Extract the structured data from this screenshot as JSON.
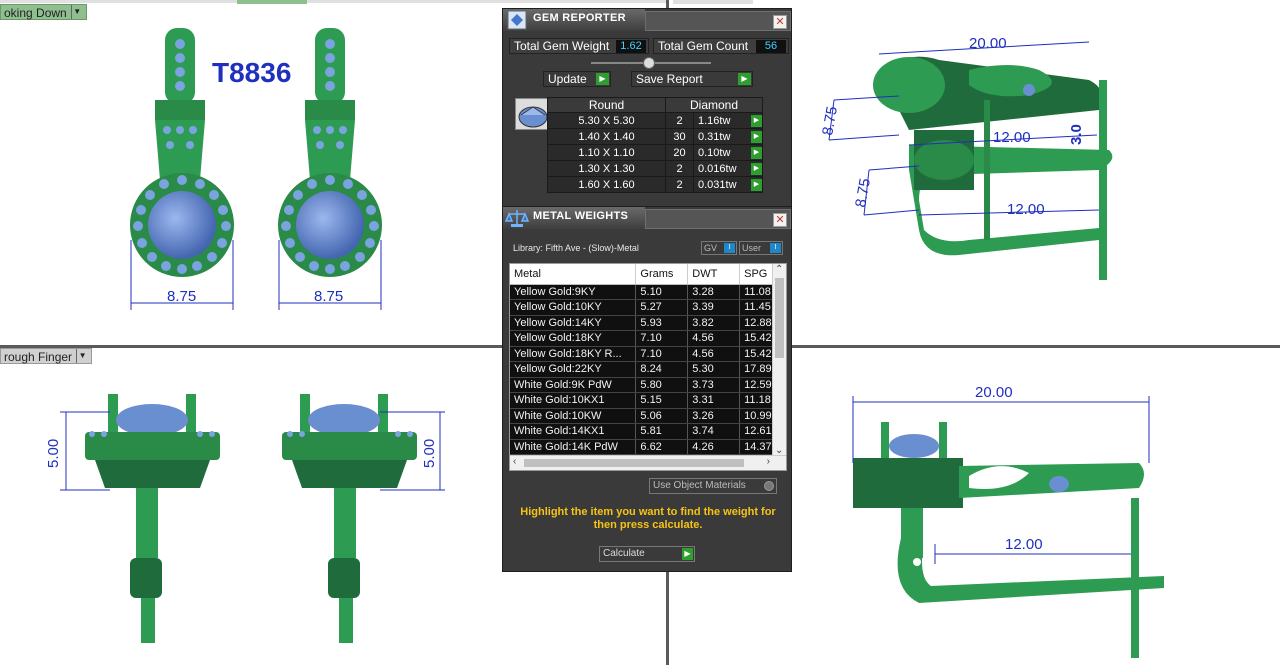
{
  "viewports": {
    "top_left": {
      "label": "oking Down",
      "part_number": "T8836",
      "dims": [
        "8.75",
        "8.75"
      ]
    },
    "top_right": {
      "dims": [
        "20.00",
        "12.00",
        "12.00",
        "8.75",
        "8.75",
        "3.0"
      ]
    },
    "bottom_left": {
      "label": "rough Finger",
      "dims": [
        "5.00",
        "5.00"
      ]
    },
    "bottom_right": {
      "dims": [
        "20.00",
        "12.00"
      ]
    }
  },
  "gem_reporter": {
    "title": "GEM REPORTER",
    "total_weight_label": "Total Gem Weight",
    "total_weight": "1.62",
    "total_count_label": "Total Gem Count",
    "total_count": "56",
    "update_label": "Update",
    "save_label": "Save Report",
    "shape_header": "Round",
    "type_header": "Diamond",
    "rows": [
      {
        "size": "5.30 X 5.30",
        "count": "2",
        "weight": "1.16tw"
      },
      {
        "size": "1.40 X 1.40",
        "count": "30",
        "weight": "0.31tw"
      },
      {
        "size": "1.10 X 1.10",
        "count": "20",
        "weight": "0.10tw"
      },
      {
        "size": "1.30 X 1.30",
        "count": "2",
        "weight": "0.016tw"
      },
      {
        "size": "1.60 X 1.60",
        "count": "2",
        "weight": "0.031tw"
      }
    ]
  },
  "metal_weights": {
    "title": "METAL WEIGHTS",
    "library": "Library: Fifth Ave - (Slow)-Metal",
    "gv_label": "GV",
    "user_label": "User",
    "headers": [
      "Metal",
      "Grams",
      "DWT",
      "SPG"
    ],
    "rows": [
      [
        "Yellow Gold:9KY",
        "5.10",
        "3.28",
        "11.08"
      ],
      [
        "Yellow Gold:10KY",
        "5.27",
        "3.39",
        "11.45"
      ],
      [
        "Yellow Gold:14KY",
        "5.93",
        "3.82",
        "12.88"
      ],
      [
        "Yellow Gold:18KY",
        "7.10",
        "4.56",
        "15.42"
      ],
      [
        "Yellow Gold:18KY R...",
        "7.10",
        "4.56",
        "15.42"
      ],
      [
        "Yellow Gold:22KY",
        "8.24",
        "5.30",
        "17.89"
      ],
      [
        "White Gold:9K PdW",
        "5.80",
        "3.73",
        "12.59"
      ],
      [
        "White Gold:10KX1",
        "5.15",
        "3.31",
        "11.18"
      ],
      [
        "White Gold:10KW",
        "5.06",
        "3.26",
        "10.99"
      ],
      [
        "White Gold:14KX1",
        "5.81",
        "3.74",
        "12.61"
      ],
      [
        "White Gold:14K PdW",
        "6.62",
        "4.26",
        "14.37"
      ]
    ],
    "use_object_label": "Use Object Materials",
    "hint": "Highlight the item you want to find the weight for then press calculate.",
    "calculate_label": "Calculate"
  },
  "colors": {
    "metal_green": "#2e9b52",
    "dark_green": "#1f6b3b",
    "gem_blue": "#6a8fd0",
    "dimension_blue": "#1f2fbf",
    "panel_bg": "#3a3a3a",
    "value_cyan": "#3cd3ff",
    "hint_yellow": "#f7c414"
  }
}
